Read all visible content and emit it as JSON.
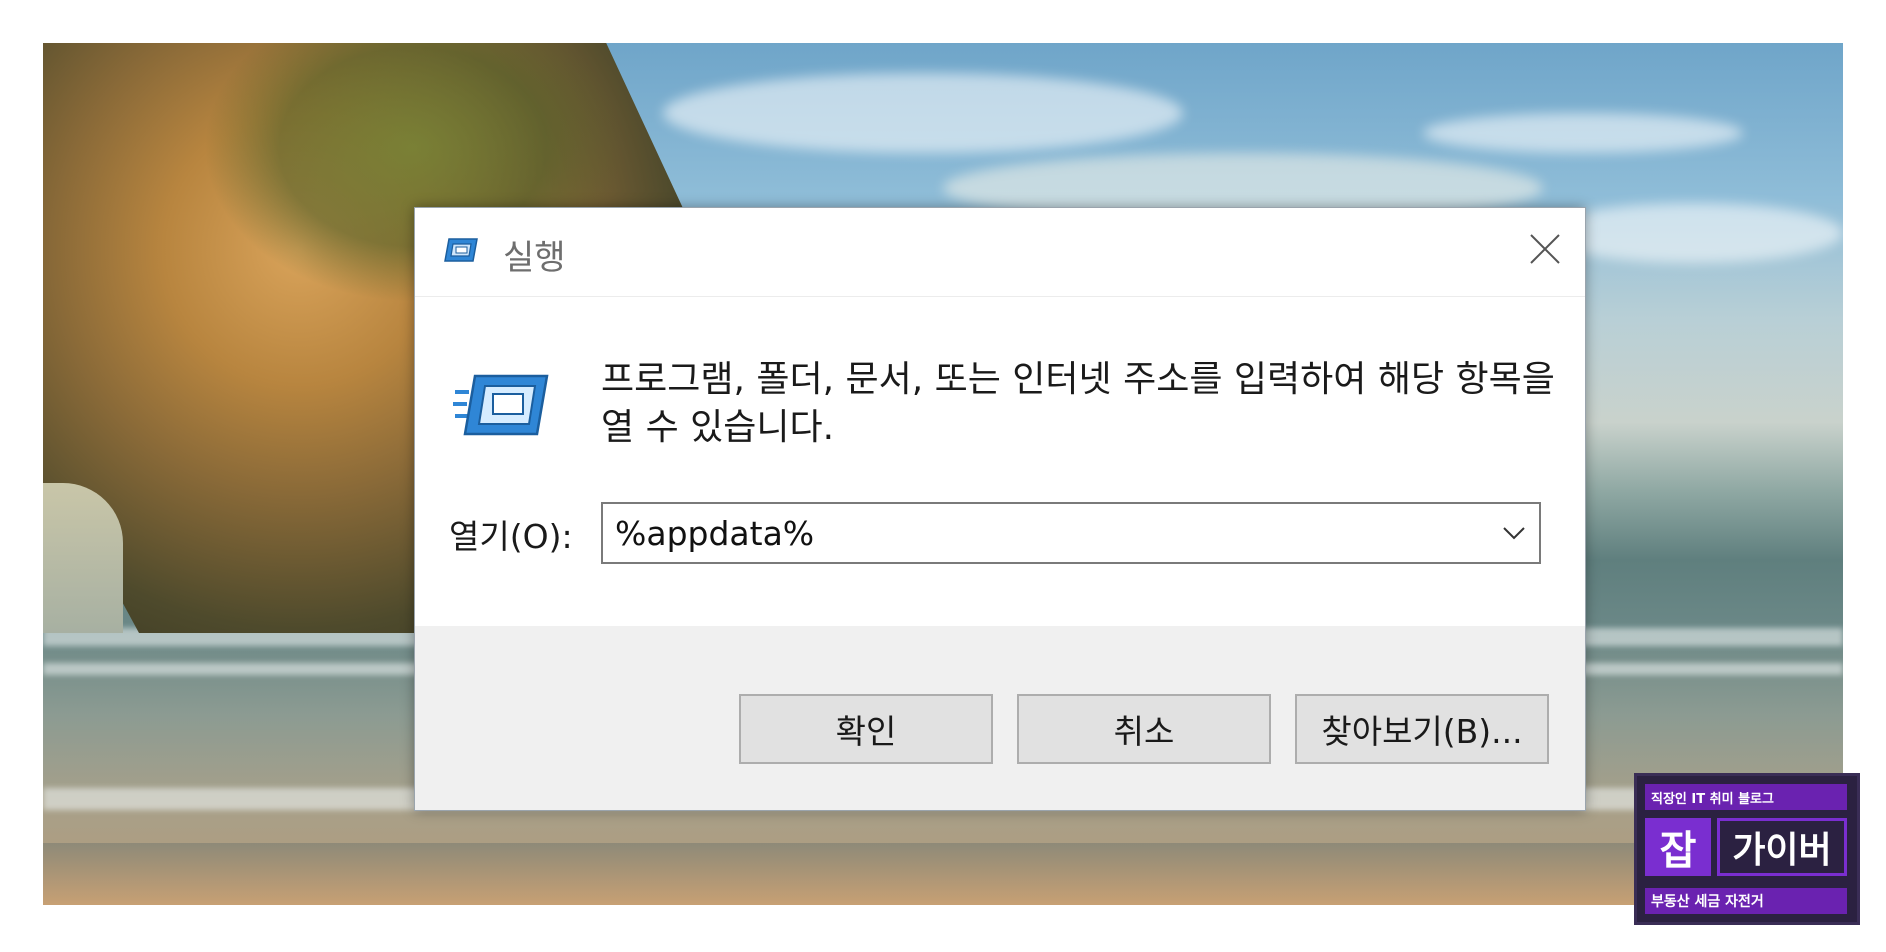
{
  "dialog": {
    "title": "실행",
    "description": "프로그램, 폴더, 문서, 또는 인터넷 주소를 입력하여 해당 항목을 열 수 있습니다.",
    "open_label": "열기(O):",
    "open_value": "%appdata%",
    "buttons": {
      "ok": "확인",
      "cancel": "취소",
      "browse": "찾아보기(B)..."
    },
    "icons": {
      "title_icon": "run-icon",
      "big_icon": "run-icon",
      "close": "close-icon",
      "dropdown": "chevron-down-icon"
    }
  },
  "badge": {
    "top_text": "직장인 IT 취미 블로그",
    "left_mark": "잡",
    "name": "가이버",
    "bottom_text": "부동산 세금 자전거",
    "color": "#6a22b0"
  }
}
